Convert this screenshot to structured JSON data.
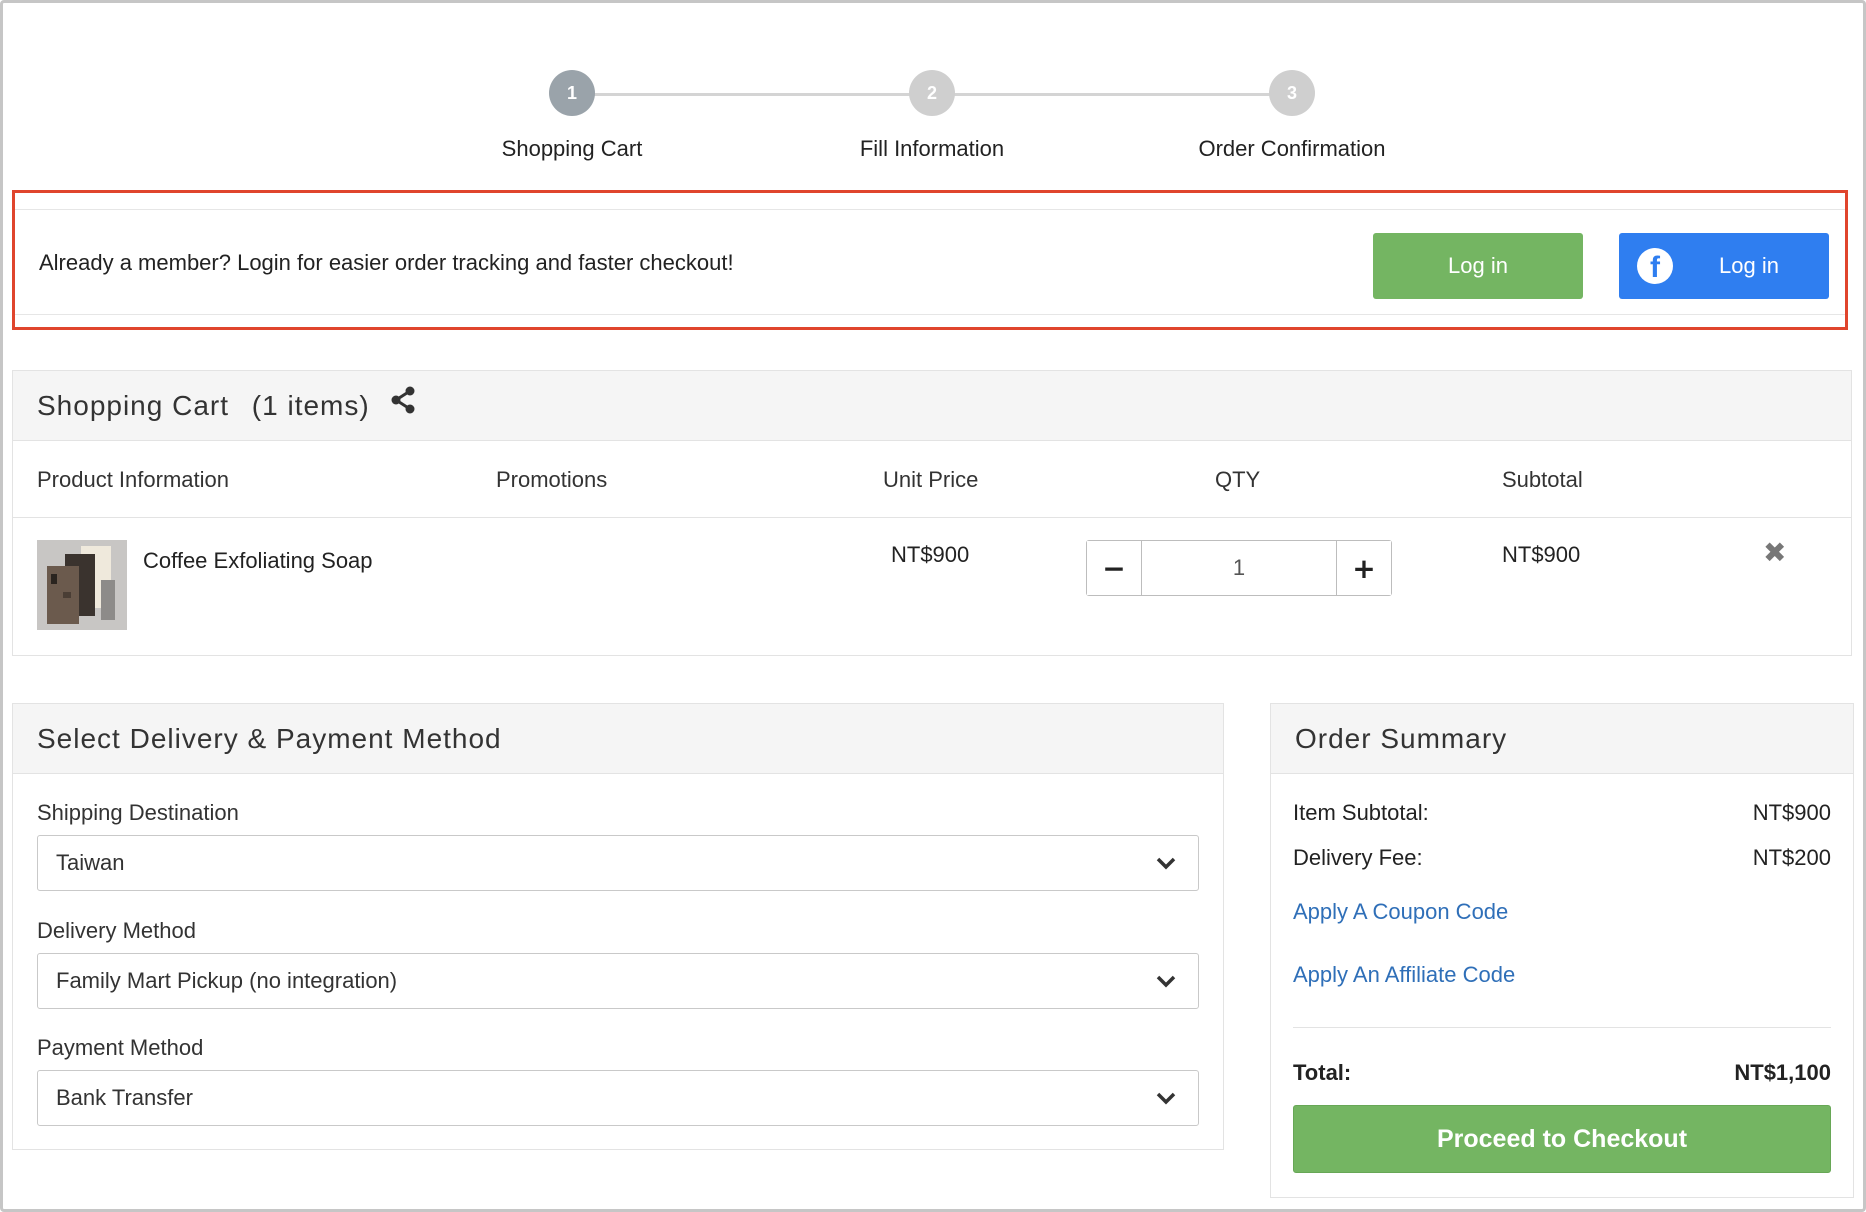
{
  "stepper": {
    "steps": [
      {
        "number": "1",
        "label": "Shopping Cart",
        "active": true
      },
      {
        "number": "2",
        "label": "Fill Information",
        "active": false
      },
      {
        "number": "3",
        "label": "Order Confirmation",
        "active": false
      }
    ]
  },
  "login_banner": {
    "message": "Already a member? Login for easier order tracking and faster checkout!",
    "login_label": "Log in",
    "facebook_login_label": "Log in",
    "highlight_color": "#e0452d"
  },
  "cart": {
    "title": "Shopping Cart",
    "count": "(1 items)",
    "columns": {
      "product": "Product Information",
      "promotions": "Promotions",
      "unit_price": "Unit Price",
      "qty": "QTY",
      "subtotal": "Subtotal"
    },
    "items": [
      {
        "name": "Coffee Exfoliating Soap",
        "unit_price": "NT$900",
        "qty": "1",
        "subtotal": "NT$900"
      }
    ]
  },
  "delivery": {
    "title": "Select Delivery & Payment Method",
    "shipping_destination": {
      "label": "Shipping Destination",
      "value": "Taiwan"
    },
    "delivery_method": {
      "label": "Delivery Method",
      "value": "Family Mart Pickup (no integration)"
    },
    "payment_method": {
      "label": "Payment Method",
      "value": "Bank Transfer"
    }
  },
  "summary": {
    "title": "Order Summary",
    "item_subtotal_label": "Item Subtotal:",
    "item_subtotal": "NT$900",
    "delivery_fee_label": "Delivery Fee:",
    "delivery_fee": "NT$200",
    "coupon_link": "Apply A Coupon Code",
    "affiliate_link": "Apply An Affiliate Code",
    "total_label": "Total:",
    "total": "NT$1,100",
    "checkout_label": "Proceed to Checkout"
  },
  "colors": {
    "brand_green": "#74b562",
    "facebook_blue": "#2f7ef0",
    "link_blue": "#2f6fb8"
  }
}
